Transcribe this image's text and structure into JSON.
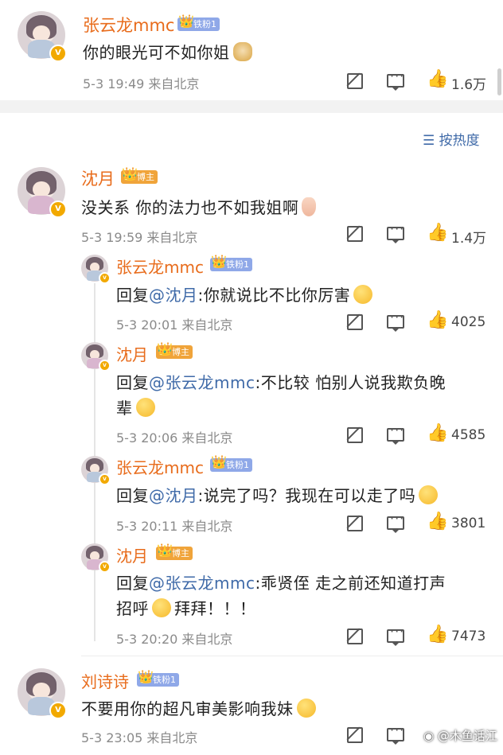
{
  "sort_label": "按热度",
  "watermark": "@木鱼话江",
  "comments": [
    {
      "user": "张云龙mmc",
      "badge": "铁粉1",
      "text": "你的眼光可不如你姐",
      "time": "5-3 19:49",
      "location": "来自北京",
      "likes": "1.6万"
    },
    {
      "user": "沈月",
      "badge": "博主",
      "text": "没关系 你的法力也不如我姐啊",
      "time": "5-3 19:59",
      "location": "来自北京",
      "likes": "1.4万",
      "replies": [
        {
          "user": "张云龙mmc",
          "badge": "铁粉1",
          "reply_prefix": "回复",
          "mention": "@沈月",
          "text": ":你就说比不比你厉害",
          "time": "5-3 20:01",
          "location": "来自北京",
          "likes": "4025"
        },
        {
          "user": "沈月",
          "badge": "博主",
          "reply_prefix": "回复",
          "mention": "@张云龙mmc",
          "text": ":不比较 怕别人说我欺负晚",
          "text_line2": "辈",
          "time": "5-3 20:06",
          "location": "来自北京",
          "likes": "4585"
        },
        {
          "user": "张云龙mmc",
          "badge": "铁粉1",
          "reply_prefix": "回复",
          "mention": "@沈月",
          "text": ":说完了吗？我现在可以走了吗",
          "time": "5-3 20:11",
          "location": "来自北京",
          "likes": "3801"
        },
        {
          "user": "沈月",
          "badge": "博主",
          "reply_prefix": "回复",
          "mention": "@张云龙mmc",
          "text": ":乖贤侄 走之前还知道打声",
          "text_line2a": "招呼",
          "text_line2b": "拜拜！！！",
          "time": "5-3 20:20",
          "location": "来自北京",
          "likes": "7473"
        }
      ]
    },
    {
      "user": "刘诗诗",
      "badge": "铁粉1",
      "text": "不要用你的超凡审美影响我妹",
      "time": "5-3 23:05",
      "location": "来自北京"
    }
  ]
}
